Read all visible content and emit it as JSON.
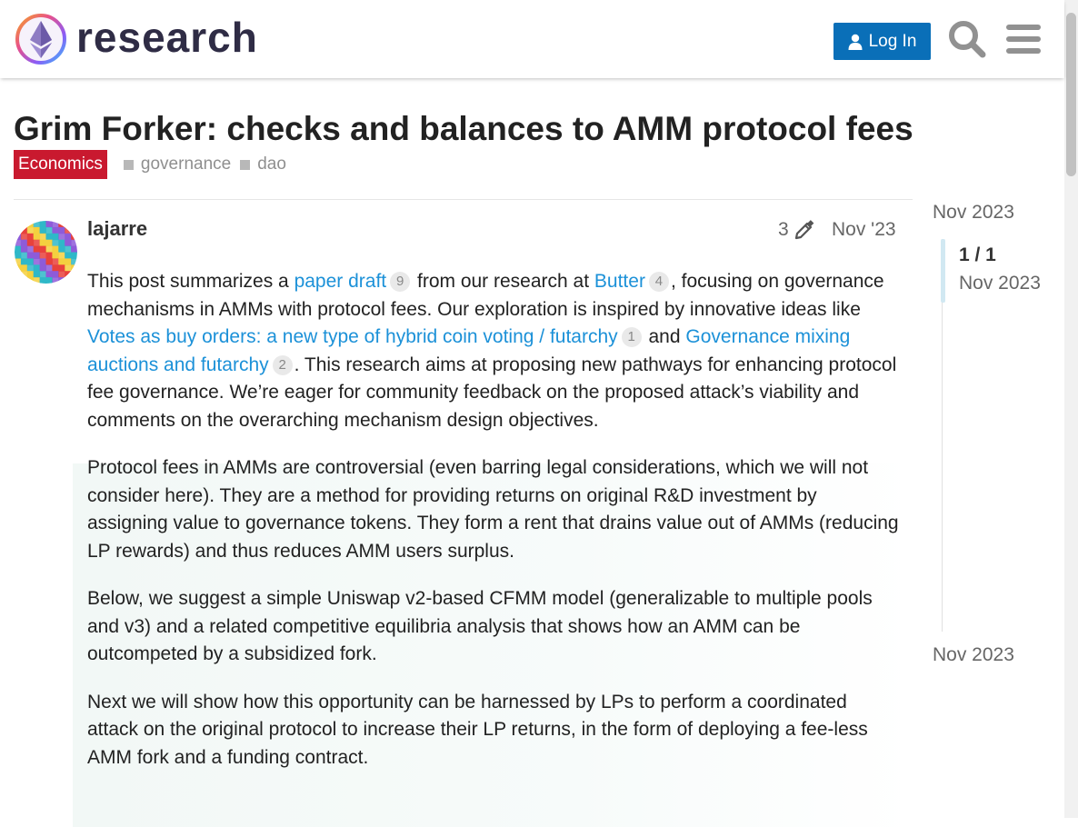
{
  "header": {
    "logo_text": "research",
    "login_label": "Log In",
    "icons": [
      "search-icon",
      "hamburger-menu-icon",
      "user-icon"
    ],
    "brand_color": "#0a6fb8"
  },
  "topic": {
    "title": "Grim Forker: checks and balances to AMM protocol fees",
    "category": "Economics",
    "category_color": "#c9192f",
    "tags": [
      "governance",
      "dao"
    ]
  },
  "post": {
    "username": "lajarre",
    "edit_count": "3",
    "date": "Nov '23",
    "p1": {
      "t1": "This post summarizes a ",
      "link1": "paper draft",
      "count1": "9",
      "t2": " from our research at ",
      "link2": "Butter",
      "count2": "4",
      "t3": ", focusing on governance mechanisms in AMMs with protocol fees. Our exploration is inspired by innovative ideas like ",
      "link3": "Votes as buy orders: a new type of hybrid coin voting / futarchy",
      "count3": "1",
      "t4": " and ",
      "link4": "Governance mixing auctions and futarchy",
      "count4": "2",
      "t5": ". This research aims at proposing new pathways for enhancing protocol fee governance. We’re eager for community feedback on the proposed attack’s viability and comments on the overarching mechanism design objectives."
    },
    "p2": "Protocol fees in AMMs are controversial (even barring legal considerations, which we will not consider here). They are a method for providing returns on original R&D investment by assigning value to governance tokens. They form a rent that drains value out of AMMs (reducing LP rewards) and thus reduces AMM users surplus.",
    "p3": "Below, we suggest a simple Uniswap v2-based CFMM model (generalizable to multiple pools and v3) and a related competitive equilibria analysis that shows how an AMM can be outcompeted by a subsidized fork.",
    "p4": "Next we will show how this opportunity can be harnessed by LPs to perform a coordinated attack on the original protocol to increase their LP returns, in the form of deploying a fee-less AMM fork and a funding contract."
  },
  "timeline": {
    "top_date": "Nov 2023",
    "position": "1 / 1",
    "position_date": "Nov 2023",
    "bottom_date": "Nov 2023",
    "progress": 1.0
  }
}
